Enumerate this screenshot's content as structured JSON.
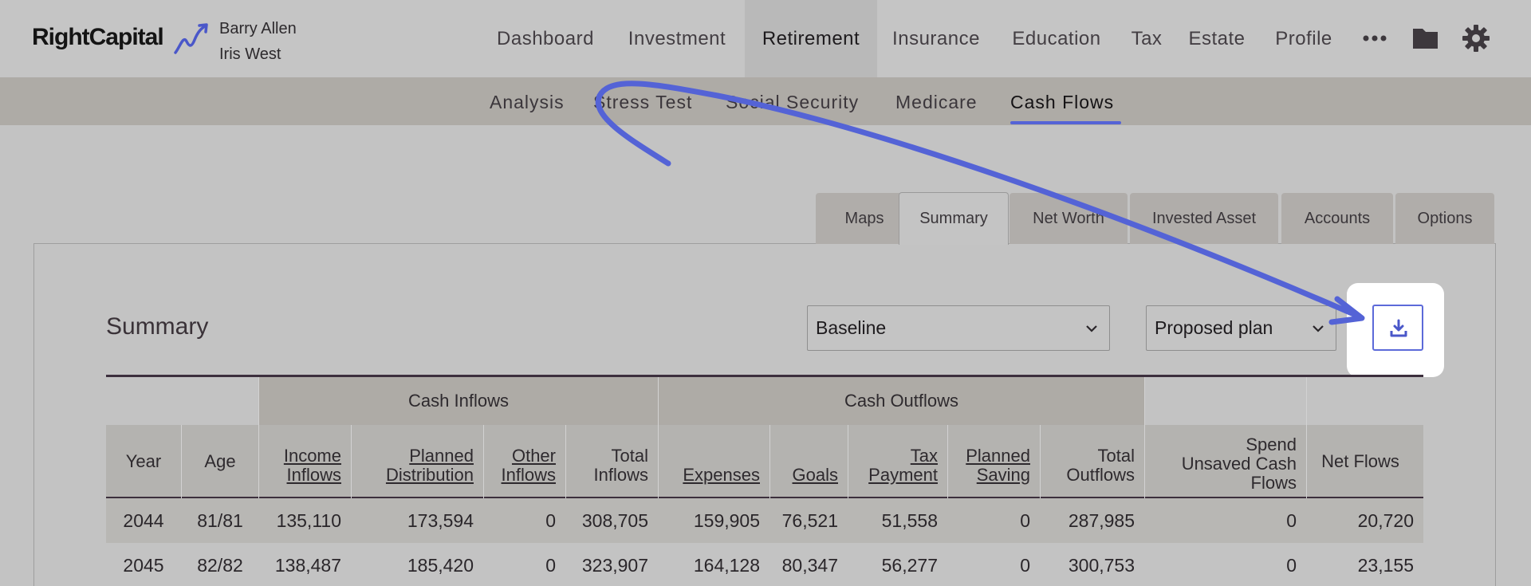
{
  "brand": {
    "name": "RightCapital",
    "accent": "#5463d6"
  },
  "clients": [
    "Barry Allen",
    "Iris West"
  ],
  "nav": {
    "items": [
      "Dashboard",
      "Investment",
      "Retirement",
      "Insurance",
      "Education",
      "Tax",
      "Estate",
      "Profile"
    ],
    "active": "Retirement",
    "icons": [
      "more-icon",
      "folder-icon",
      "settings-icon"
    ]
  },
  "subnav": {
    "items": [
      "Analysis",
      "Stress Test",
      "Social Security",
      "Medicare",
      "Cash Flows"
    ],
    "active": "Cash Flows"
  },
  "tabs": {
    "items": [
      "Maps",
      "Summary",
      "Net Worth",
      "Invested Asset",
      "Accounts",
      "Options"
    ],
    "active": "Summary"
  },
  "panel": {
    "title": "Summary",
    "baseline_select": "Baseline",
    "plan_select": "Proposed plan",
    "download_icon": "download-icon"
  },
  "table": {
    "groups": {
      "inflows": "Cash Inflows",
      "outflows": "Cash Outflows"
    },
    "headers": {
      "year": "Year",
      "age": "Age",
      "income_inflows": [
        "Income",
        "Inflows"
      ],
      "planned_distribution": [
        "Planned",
        "Distribution"
      ],
      "other_inflows": [
        "Other",
        "Inflows"
      ],
      "total_inflows": [
        "Total",
        "Inflows"
      ],
      "expenses": "Expenses",
      "goals": "Goals",
      "tax_payment": [
        "Tax",
        "Payment"
      ],
      "planned_saving": [
        "Planned",
        "Saving"
      ],
      "total_outflows": [
        "Total",
        "Outflows"
      ],
      "spend_unsaved": [
        "Spend",
        "Unsaved Cash",
        "Flows"
      ],
      "net_flows": "Net Flows"
    },
    "rows": [
      [
        "2044",
        "81/81",
        "135,110",
        "173,594",
        "0",
        "308,705",
        "159,905",
        "76,521",
        "51,558",
        "0",
        "287,985",
        "0",
        "20,720"
      ],
      [
        "2045",
        "82/82",
        "138,487",
        "185,420",
        "0",
        "323,907",
        "164,128",
        "80,347",
        "56,277",
        "0",
        "300,753",
        "0",
        "23,155"
      ]
    ]
  }
}
